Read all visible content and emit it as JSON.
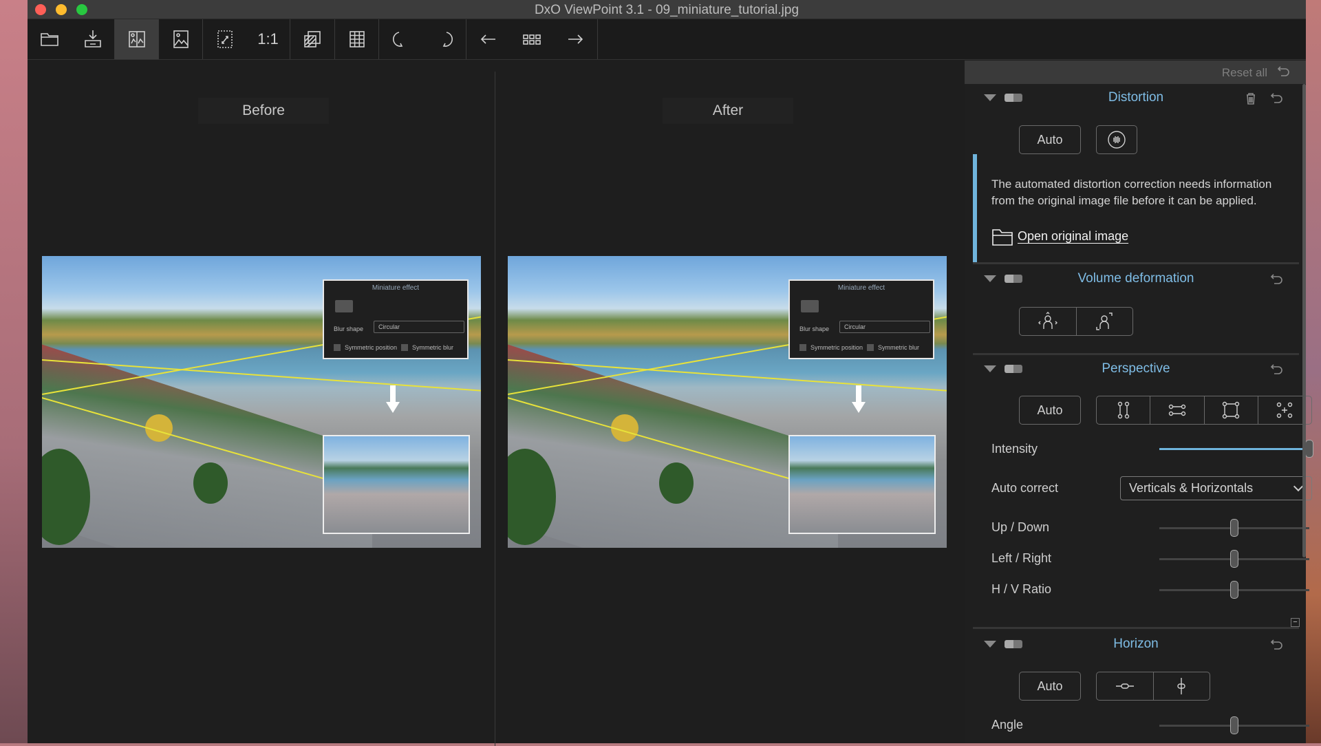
{
  "window": {
    "title": "DxO ViewPoint 3.1 - 09_miniature_tutorial.jpg"
  },
  "toolbar": {
    "items": [
      {
        "icon": "folder-icon"
      },
      {
        "icon": "export-icon"
      },
      {
        "icon": "before-after-icon",
        "active": true
      },
      {
        "icon": "image-icon"
      },
      {
        "icon": "fit-screen-icon"
      },
      {
        "icon": "actual-size-icon",
        "label": "1:1"
      },
      {
        "icon": "overlay-icon"
      },
      {
        "icon": "grid-icon"
      },
      {
        "icon": "rotate-left-icon"
      },
      {
        "icon": "rotate-right-icon"
      },
      {
        "icon": "previous-icon"
      },
      {
        "icon": "thumbnails-icon"
      },
      {
        "icon": "next-icon"
      }
    ]
  },
  "viewer": {
    "before_label": "Before",
    "after_label": "After",
    "embedded_panel": {
      "title": "Miniature effect",
      "blur_shape_label": "Blur shape",
      "blur_shape_value": "Circular",
      "symmetric_position": "Symmetric position",
      "symmetric_blur": "Symmetric blur"
    }
  },
  "panel": {
    "reset_all": "Reset all",
    "accent_color": "#7fbde6",
    "distortion": {
      "title": "Distortion",
      "auto": "Auto",
      "info": "The automated distortion correction needs information from the original image file before it can be applied.",
      "open_original": "Open original image"
    },
    "volume": {
      "title": "Volume deformation"
    },
    "perspective": {
      "title": "Perspective",
      "auto": "Auto",
      "intensity_label": "Intensity",
      "intensity_value": 100,
      "auto_correct_label": "Auto correct",
      "auto_correct_value": "Verticals & Horizontals",
      "up_down_label": "Up / Down",
      "up_down_value": 50,
      "left_right_label": "Left / Right",
      "left_right_value": 50,
      "hv_ratio_label": "H / V Ratio",
      "hv_ratio_value": 50
    },
    "horizon": {
      "title": "Horizon",
      "auto": "Auto",
      "angle_label": "Angle",
      "angle_value": 50
    }
  }
}
